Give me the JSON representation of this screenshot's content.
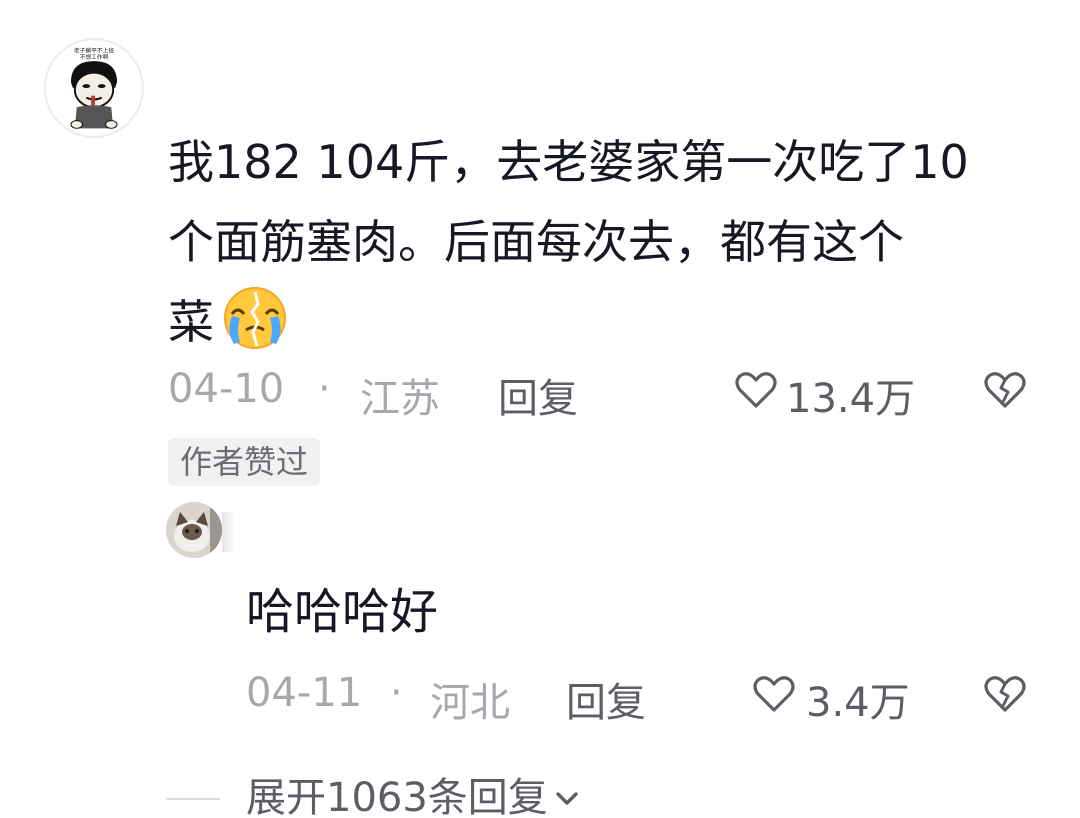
{
  "comment": {
    "avatar_caption": "老子躺平不上班，不想工作啊",
    "text_line1": "我182 104斤，去老婆家第一次吃了10",
    "text_line2": "个面筋塞肉。后面每次去，都有这个",
    "text_line3": "菜",
    "emoji": "crying-face-emoji",
    "date": "04-10",
    "separator": "·",
    "region": "江苏",
    "reply_label": "回复",
    "likes": "13.4万",
    "badge": "作者赞过"
  },
  "reply": {
    "text": "哈哈哈好",
    "date": "04-11",
    "separator": "·",
    "region": "河北",
    "reply_label": "回复",
    "likes": "3.4万"
  },
  "expand": {
    "label": "展开1063条回复"
  },
  "colors": {
    "text_primary": "#161823",
    "text_secondary": "#a6a8ad",
    "text_action": "#5c5e66",
    "badge_bg": "#f1f1f2"
  }
}
